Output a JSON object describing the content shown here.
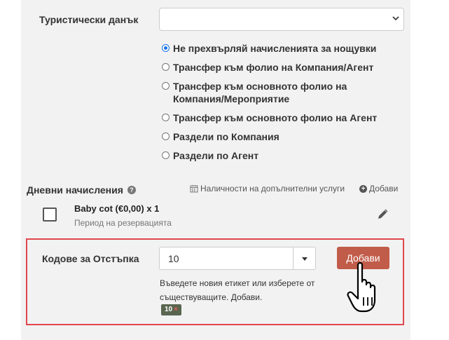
{
  "tourist_tax": {
    "label": "Туристически данък",
    "select_value": ""
  },
  "transfer_options": [
    {
      "label": "Не прехвърляй начисленията за нощувки",
      "checked": true
    },
    {
      "label": "Трансфер към фолио на Компания/Агент",
      "checked": false
    },
    {
      "label": "Трансфер към основното фолио на Компания/Мероприятие",
      "checked": false
    },
    {
      "label": "Трансфер към основното фолио на Агент",
      "checked": false
    },
    {
      "label": "Раздели по Компания",
      "checked": false
    },
    {
      "label": "Раздели по Агент",
      "checked": false
    }
  ],
  "daily_charges": {
    "title": "Дневни начисления",
    "availability_link": "Наличности на допълнителни услуги",
    "add_link": "Добави",
    "item": {
      "name": "Baby cot (€0,00) x 1",
      "period": "Период на резервацията",
      "checked": false
    }
  },
  "discount_codes": {
    "label": "Кодове за Отстъпка",
    "input_value": "10",
    "add_button": "Добави",
    "hint": "Въведете новия етикет или изберете от съществуващите. Добави.",
    "tags": [
      {
        "text": "10",
        "remove": "×"
      }
    ]
  },
  "colors": {
    "panel_bg": "#f2f2f2",
    "highlight_border": "#e0474c",
    "add_button_bg": "#c25c4a",
    "radio_checked": "#1a73e8",
    "tag_bg": "#5a6650"
  },
  "icons": {
    "help": "help-icon",
    "calendar": "calendar-icon",
    "plus": "plus-circle-icon",
    "edit": "pencil-icon",
    "cursor": "hand-cursor-icon"
  }
}
